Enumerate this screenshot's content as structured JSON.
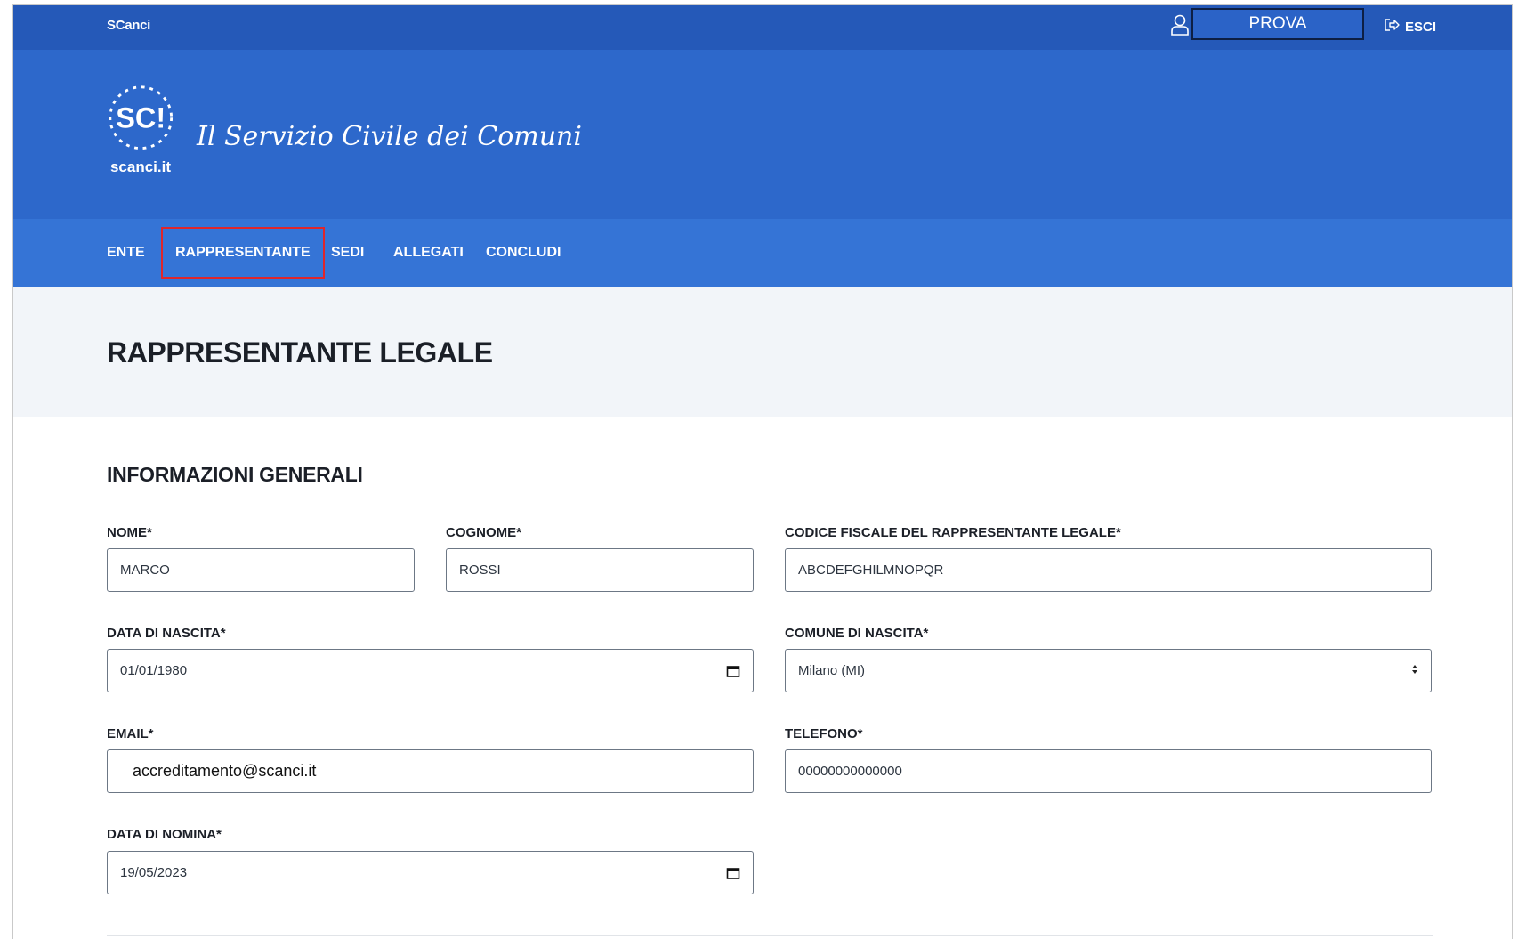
{
  "topbar": {
    "brand": "SCanci",
    "user_name": "PROVA",
    "logout_label": "ESCI"
  },
  "header": {
    "logo_text": "scanci.it",
    "logo_mark": "SC!",
    "site_title": "Il Servizio Civile dei Comuni"
  },
  "nav": {
    "items": [
      {
        "label": "ENTE"
      },
      {
        "label": "RAPPRESENTANTE"
      },
      {
        "label": "SEDI"
      },
      {
        "label": "ALLEGATI"
      },
      {
        "label": "CONCLUDI"
      }
    ],
    "active_index": 1
  },
  "page": {
    "title": "RAPPRESENTANTE LEGALE",
    "section_title": "INFORMAZIONI GENERALI"
  },
  "form": {
    "nome": {
      "label": "NOME*",
      "value": "MARCO"
    },
    "cognome": {
      "label": "COGNOME*",
      "value": "ROSSI"
    },
    "codice_fiscale": {
      "label": "CODICE FISCALE DEL RAPPRESENTANTE LEGALE*",
      "value": "ABCDEFGHILMNOPQR"
    },
    "data_nascita": {
      "label": "DATA DI NASCITA*",
      "value": "01/01/1980"
    },
    "comune_nascita": {
      "label": "COMUNE DI NASCITA*",
      "value": "Milano (MI)"
    },
    "email": {
      "label": "EMAIL*",
      "value": "accreditamento@scanci.it"
    },
    "telefono": {
      "label": "TELEFONO*",
      "value": "00000000000000"
    },
    "data_nomina": {
      "label": "DATA DI NOMINA*",
      "value": "19/05/2023"
    }
  },
  "icons": {
    "user": "user-icon",
    "logout": "logout-icon",
    "calendar": "calendar-icon",
    "select": "select-arrows-icon"
  },
  "colors": {
    "topbar": "#2559b8",
    "header": "#2d68cb",
    "navbar": "#3574d6",
    "active_outline": "#e0262a",
    "title_band": "#f2f5f9"
  }
}
